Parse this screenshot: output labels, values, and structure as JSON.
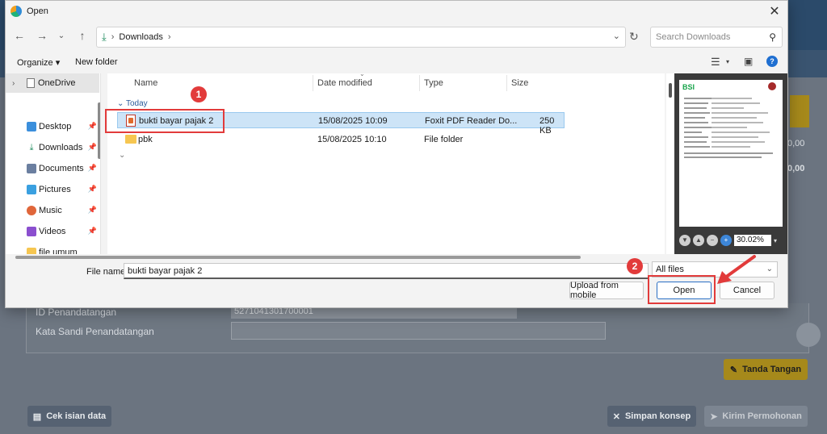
{
  "background": {
    "fields": [
      {
        "label": "ID Penandatangan",
        "value": "5271041301700001"
      },
      {
        "label": "Kata Sandi Penandatangan",
        "value": ""
      }
    ],
    "right_values": [
      "0,00",
      "0,00"
    ],
    "buttons": {
      "tanda_tangan": "Tanda Tangan",
      "cek_isian": "Cek isian data",
      "simpan_konsep": "Simpan konsep",
      "kirim_permohonan": "Kirim Permohonan"
    }
  },
  "dialog": {
    "title": "Open",
    "address": {
      "crumb": "Downloads"
    },
    "search": {
      "placeholder": "Search Downloads"
    },
    "toolbar": {
      "organize": "Organize",
      "new_folder": "New folder"
    },
    "nav": {
      "onedrive": "OneDrive",
      "items": [
        {
          "label": "Desktop",
          "icon": "desktop-icon"
        },
        {
          "label": "Downloads",
          "icon": "download-icon"
        },
        {
          "label": "Documents",
          "icon": "documents-icon"
        },
        {
          "label": "Pictures",
          "icon": "pictures-icon"
        },
        {
          "label": "Music",
          "icon": "music-icon"
        },
        {
          "label": "Videos",
          "icon": "videos-icon"
        },
        {
          "label": "file umum",
          "icon": "folder-icon"
        }
      ]
    },
    "columns": {
      "name": "Name",
      "date": "Date modified",
      "type": "Type",
      "size": "Size"
    },
    "group": "Today",
    "files": [
      {
        "name": "bukti bayar pajak 2",
        "date": "15/08/2025 10:09",
        "type": "Foxit PDF Reader Do...",
        "size": "250 KB",
        "selected": true,
        "icon": "pdf-icon"
      },
      {
        "name": "pbk",
        "date": "15/08/2025 10:10",
        "type": "File folder",
        "size": "",
        "selected": false,
        "icon": "folder-icon"
      }
    ],
    "preview": {
      "zoom": "30.02%",
      "doc_header": "BSI"
    },
    "file_name": {
      "label": "File name:",
      "value": "bukti bayar pajak 2"
    },
    "file_type": "All files",
    "buttons": {
      "upload": "Upload from mobile",
      "open": "Open",
      "cancel": "Cancel"
    },
    "annotations": {
      "step1": "1",
      "step2": "2"
    },
    "colors": {
      "annotation": "#e23b3b",
      "selection": "#cde4f7",
      "primary_border": "#2a6fc4"
    }
  }
}
